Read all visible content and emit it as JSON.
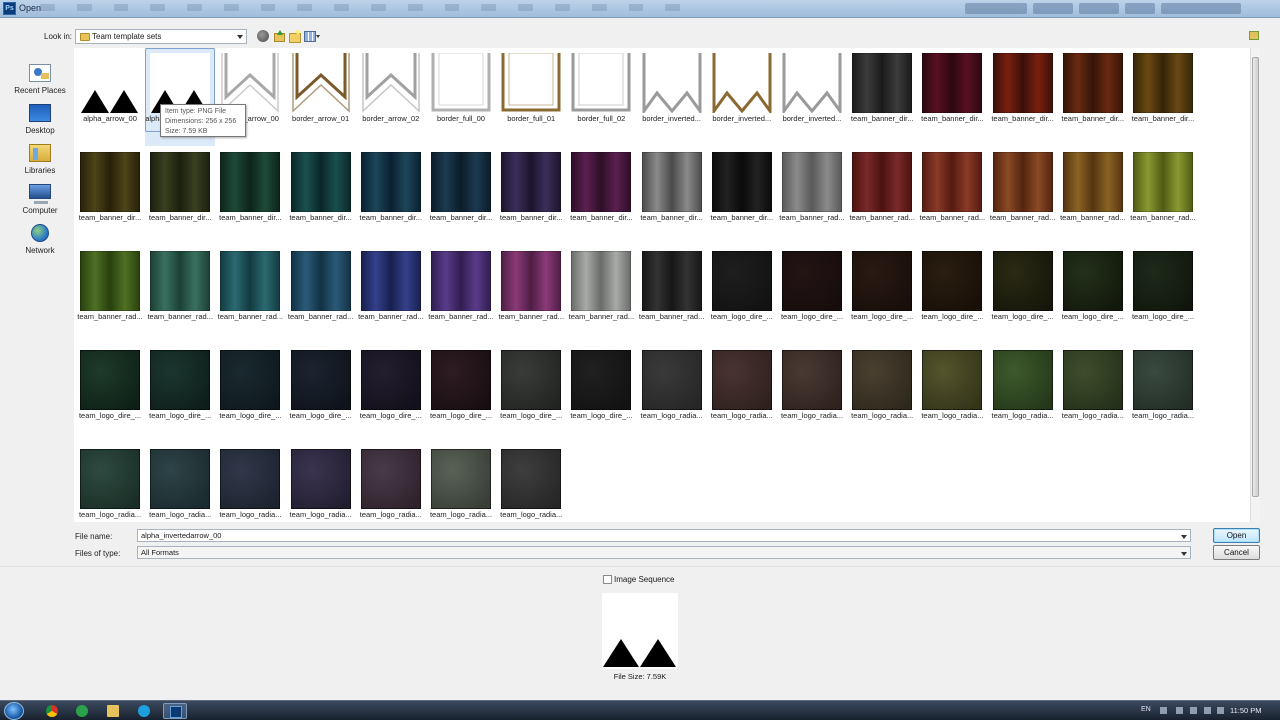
{
  "window": {
    "title": "Open",
    "app_icon": "Ps"
  },
  "toolbar": {
    "look_in_label": "Look in:",
    "look_in_value": "Team template sets"
  },
  "places": [
    {
      "label": "Recent Places",
      "icon": "recent-places-icon"
    },
    {
      "label": "Desktop",
      "icon": "desktop-icon"
    },
    {
      "label": "Libraries",
      "icon": "libraries-icon"
    },
    {
      "label": "Computer",
      "icon": "computer-icon"
    },
    {
      "label": "Network",
      "icon": "network-icon"
    }
  ],
  "files": [
    {
      "name": "alpha_arrow_00",
      "kind": "arrow",
      "fill": "#000000",
      "bg": "#ffffff"
    },
    {
      "name": "alpha_invertedarrow_00",
      "kind": "arrow",
      "fill": "#000000",
      "bg": "#ffffff",
      "selected": true
    },
    {
      "name": "border_arrow_00",
      "kind": "border_arrow",
      "fill": "#a8a8a8",
      "bg": "#ffffff"
    },
    {
      "name": "border_arrow_01",
      "kind": "border_arrow",
      "fill": "#7a5a2a",
      "bg": "#ffffff"
    },
    {
      "name": "border_arrow_02",
      "kind": "border_arrow",
      "fill": "#a0a0a0",
      "bg": "#ffffff"
    },
    {
      "name": "border_full_00",
      "kind": "border_full",
      "fill": "#b0b0b0",
      "bg": "#ffffff"
    },
    {
      "name": "border_full_01",
      "kind": "border_full",
      "fill": "#8a6a32",
      "bg": "#ffffff"
    },
    {
      "name": "border_full_02",
      "kind": "border_full",
      "fill": "#9a9a9a",
      "bg": "#ffffff"
    },
    {
      "name": "border_inverted...",
      "kind": "border_inv",
      "fill": "#9a9a9a",
      "bg": "#ffffff"
    },
    {
      "name": "border_inverted...",
      "kind": "border_inv",
      "fill": "#8a6a32",
      "bg": "#ffffff"
    },
    {
      "name": "border_inverted...",
      "kind": "border_inv",
      "fill": "#9a9a9a",
      "bg": "#ffffff"
    },
    {
      "name": "team_banner_dir...",
      "kind": "curtain",
      "fill": "#3c3c3c",
      "bg": "#1a1a1a"
    },
    {
      "name": "team_banner_dir...",
      "kind": "curtain",
      "fill": "#5a1020",
      "bg": "#2a0810"
    },
    {
      "name": "team_banner_dir...",
      "kind": "curtain",
      "fill": "#7a2010",
      "bg": "#3a1008"
    },
    {
      "name": "team_banner_dir...",
      "kind": "curtain",
      "fill": "#6a2a10",
      "bg": "#341408"
    },
    {
      "name": "team_banner_dir...",
      "kind": "curtain",
      "fill": "#6a4a12",
      "bg": "#342408"
    },
    {
      "name": "team_banner_dir...",
      "kind": "curtain",
      "fill": "#4e4418",
      "bg": "#262008"
    },
    {
      "name": "team_banner_dir...",
      "kind": "curtain",
      "fill": "#3a4020",
      "bg": "#1a200e"
    },
    {
      "name": "team_banner_dir...",
      "kind": "curtain",
      "fill": "#1e4a38",
      "bg": "#0c241a"
    },
    {
      "name": "team_banner_dir...",
      "kind": "curtain",
      "fill": "#1a5050",
      "bg": "#0a2626"
    },
    {
      "name": "team_banner_dir...",
      "kind": "curtain",
      "fill": "#1c4658",
      "bg": "#0a2030"
    },
    {
      "name": "team_banner_dir...",
      "kind": "curtain",
      "fill": "#1c3a50",
      "bg": "#0a1c28"
    },
    {
      "name": "team_banner_dir...",
      "kind": "curtain",
      "fill": "#3c2e5a",
      "bg": "#1c142e"
    },
    {
      "name": "team_banner_dir...",
      "kind": "curtain",
      "fill": "#5a2050",
      "bg": "#2e0e28"
    },
    {
      "name": "team_banner_dir...",
      "kind": "curtain",
      "fill": "#8a8a8a",
      "bg": "#4a4a4a"
    },
    {
      "name": "team_banner_dir...",
      "kind": "curtain",
      "fill": "#222222",
      "bg": "#0a0a0a"
    },
    {
      "name": "team_banner_rad...",
      "kind": "curtain",
      "fill": "#8a8a8a",
      "bg": "#5a5a5a"
    },
    {
      "name": "team_banner_rad...",
      "kind": "curtain",
      "fill": "#7a2a28",
      "bg": "#4a1210"
    },
    {
      "name": "team_banner_rad...",
      "kind": "curtain",
      "fill": "#8a3a28",
      "bg": "#541a10"
    },
    {
      "name": "team_banner_rad...",
      "kind": "curtain",
      "fill": "#8a4a24",
      "bg": "#542410"
    },
    {
      "name": "team_banner_rad...",
      "kind": "curtain",
      "fill": "#8a6424",
      "bg": "#543410"
    },
    {
      "name": "team_banner_rad...",
      "kind": "curtain",
      "fill": "#8a9a30",
      "bg": "#505a14"
    },
    {
      "name": "team_banner_rad...",
      "kind": "curtain",
      "fill": "#4e7024",
      "bg": "#28400e"
    },
    {
      "name": "team_banner_rad...",
      "kind": "curtain",
      "fill": "#3a7060",
      "bg": "#1a4034"
    },
    {
      "name": "team_banner_rad...",
      "kind": "curtain",
      "fill": "#2a6a70",
      "bg": "#123a40"
    },
    {
      "name": "team_banner_rad...",
      "kind": "curtain",
      "fill": "#2a5a78",
      "bg": "#123244"
    },
    {
      "name": "team_banner_rad...",
      "kind": "curtain",
      "fill": "#34408a",
      "bg": "#18204e"
    },
    {
      "name": "team_banner_rad...",
      "kind": "curtain",
      "fill": "#5a3a8a",
      "bg": "#301e50"
    },
    {
      "name": "team_banner_rad...",
      "kind": "curtain",
      "fill": "#8a3a78",
      "bg": "#4e1e44"
    },
    {
      "name": "team_banner_rad...",
      "kind": "curtain",
      "fill": "#a8aaa8",
      "bg": "#6a6c6a"
    },
    {
      "name": "team_banner_rad...",
      "kind": "curtain",
      "fill": "#333333",
      "bg": "#161616"
    },
    {
      "name": "team_logo_dire_...",
      "kind": "logo",
      "fill": "#1e1e1e",
      "bg": "#121212"
    },
    {
      "name": "team_logo_dire_...",
      "kind": "logo",
      "fill": "#241414",
      "bg": "#160c0c"
    },
    {
      "name": "team_logo_dire_...",
      "kind": "logo",
      "fill": "#2a1a12",
      "bg": "#180e0a"
    },
    {
      "name": "team_logo_dire_...",
      "kind": "logo",
      "fill": "#2a1e10",
      "bg": "#180f08"
    },
    {
      "name": "team_logo_dire_...",
      "kind": "logo",
      "fill": "#2a2a14",
      "bg": "#16160a"
    },
    {
      "name": "team_logo_dire_...",
      "kind": "logo",
      "fill": "#24301a",
      "bg": "#12180c"
    },
    {
      "name": "team_logo_dire_...",
      "kind": "logo",
      "fill": "#1e2a1a",
      "bg": "#10160c"
    },
    {
      "name": "team_logo_dire_...",
      "kind": "logo",
      "fill": "#1e3a2a",
      "bg": "#0e2016"
    },
    {
      "name": "team_logo_dire_...",
      "kind": "logo",
      "fill": "#1c3630",
      "bg": "#0e1e1a"
    },
    {
      "name": "team_logo_dire_...",
      "kind": "logo",
      "fill": "#1a2a30",
      "bg": "#0e181c"
    },
    {
      "name": "team_logo_dire_...",
      "kind": "logo",
      "fill": "#1c2430",
      "bg": "#0e121a"
    },
    {
      "name": "team_logo_dire_...",
      "kind": "logo",
      "fill": "#241e30",
      "bg": "#12101a"
    },
    {
      "name": "team_logo_dire_...",
      "kind": "logo",
      "fill": "#2e1c22",
      "bg": "#180e12"
    },
    {
      "name": "team_logo_dire_...",
      "kind": "logo",
      "fill": "#3a3c3a",
      "bg": "#222422"
    },
    {
      "name": "team_logo_dire_...",
      "kind": "logo",
      "fill": "#202020",
      "bg": "#121212"
    },
    {
      "name": "team_logo_radia...",
      "kind": "logo",
      "fill": "#3a3a3a",
      "bg": "#262626"
    },
    {
      "name": "team_logo_radia...",
      "kind": "logo",
      "fill": "#4a3432",
      "bg": "#2e201e"
    },
    {
      "name": "team_logo_radia...",
      "kind": "logo",
      "fill": "#4a3a32",
      "bg": "#2e221e"
    },
    {
      "name": "team_logo_radia...",
      "kind": "logo",
      "fill": "#4a4030",
      "bg": "#2e281c"
    },
    {
      "name": "team_logo_radia...",
      "kind": "logo",
      "fill": "#54542c",
      "bg": "#34341a"
    },
    {
      "name": "team_logo_radia...",
      "kind": "logo",
      "fill": "#3e5a2c",
      "bg": "#24381a"
    },
    {
      "name": "team_logo_radia...",
      "kind": "logo",
      "fill": "#3e4e2c",
      "bg": "#24301a"
    },
    {
      "name": "team_logo_radia...",
      "kind": "logo",
      "fill": "#3a4a40",
      "bg": "#222e26"
    },
    {
      "name": "team_logo_radia...",
      "kind": "logo",
      "fill": "#2e4a40",
      "bg": "#1a2e26"
    },
    {
      "name": "team_logo_radia...",
      "kind": "logo",
      "fill": "#2e4448",
      "bg": "#1a2a2e"
    },
    {
      "name": "team_logo_radia...",
      "kind": "logo",
      "fill": "#30384a",
      "bg": "#1c222e"
    },
    {
      "name": "team_logo_radia...",
      "kind": "logo",
      "fill": "#3a3450",
      "bg": "#221e30"
    },
    {
      "name": "team_logo_radia...",
      "kind": "logo",
      "fill": "#4a3a48",
      "bg": "#2e222c"
    },
    {
      "name": "team_logo_radia...",
      "kind": "logo",
      "fill": "#5a6258",
      "bg": "#383e36"
    },
    {
      "name": "team_logo_radia...",
      "kind": "logo",
      "fill": "#3e3e3e",
      "bg": "#262626"
    }
  ],
  "tooltip": {
    "type": "Item type: PNG File",
    "dimensions": "Dimensions: 256 x 256",
    "size": "Size: 7.59 KB"
  },
  "file_name": {
    "label": "File name:",
    "value": "alpha_invertedarrow_00"
  },
  "file_type": {
    "label": "Files of type:",
    "value": "All Formats"
  },
  "buttons": {
    "open": "Open",
    "cancel": "Cancel"
  },
  "preview": {
    "image_sequence_label": "Image Sequence",
    "image_sequence_checked": false,
    "file_size": "File Size: 7.59K"
  },
  "taskbar": {
    "language": "EN",
    "clock": "11:50 PM"
  }
}
